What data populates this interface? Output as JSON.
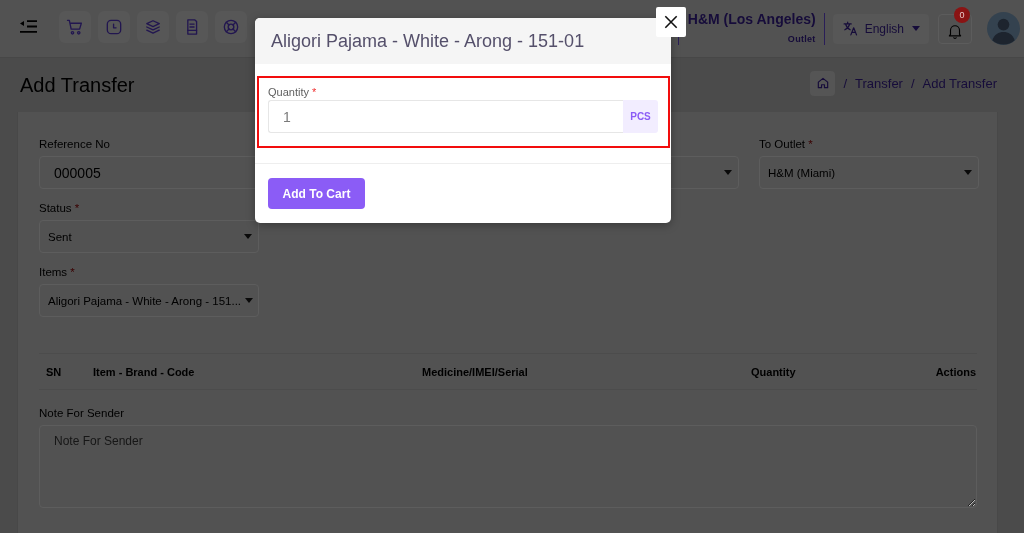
{
  "topbar": {
    "outlet": {
      "name": "H&M (Los Angeles)",
      "caption": "Outlet"
    },
    "language": {
      "label": "English"
    },
    "notifications": {
      "count": "0"
    }
  },
  "page_header": {
    "title": "Add Transfer",
    "breadcrumb": [
      {
        "separator": "/",
        "label": "Transfer"
      },
      {
        "separator": "/",
        "label": "Add Transfer"
      }
    ]
  },
  "form": {
    "rows": [
      {
        "fields": [
          {
            "kind": "input",
            "label": "Reference No",
            "value": "000005"
          },
          {
            "kind": "select"
          },
          {
            "kind": "select",
            "label": "To Outlet",
            "required_mark": "*",
            "value": "H&M (Miami)"
          }
        ]
      },
      {
        "fields": [
          {
            "kind": "select",
            "label": "Status",
            "required_mark": "*",
            "value": "Sent"
          }
        ]
      },
      {
        "fields": [
          {
            "kind": "select",
            "label": "Items",
            "required_mark": "*",
            "value": "Aligori Pajama - White - Arong - 151..."
          }
        ]
      }
    ],
    "table": {
      "columns": [
        "SN",
        "Item - Brand - Code",
        "Medicine/IMEI/Serial",
        "Quantity",
        "Actions"
      ]
    },
    "note": {
      "label": "Note For Sender",
      "placeholder": "Note For Sender"
    }
  },
  "modal": {
    "title": "Aligori Pajama - White - Arong - 151-01",
    "field": {
      "label": "Quantity",
      "required_mark": "*",
      "value": "1",
      "unit": "PCS",
      "highlighted": true
    },
    "button": "Add To Cart"
  }
}
